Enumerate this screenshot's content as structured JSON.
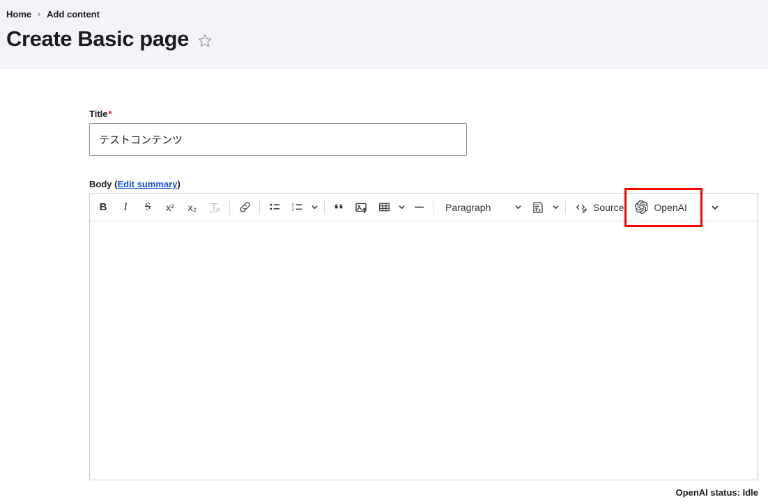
{
  "header": {
    "breadcrumb": [
      {
        "label": "Home",
        "icon": ""
      },
      {
        "label": "Add content",
        "icon": ""
      }
    ],
    "separator": "›",
    "title": "Create Basic page",
    "star_icon": "star-outline-icon",
    "bg_color": "#f3f4f9"
  },
  "form": {
    "title_field": {
      "label": "Title",
      "required_mark": "*",
      "value": "テストコンテンツ",
      "placeholder": ""
    },
    "body_field": {
      "label_prefix": "Body (",
      "edit_summary_link": "Edit summary",
      "label_suffix": ")",
      "content": "",
      "placeholder": ""
    }
  },
  "editor": {
    "toolbar": [
      {
        "id": "bold",
        "name": "bold-button",
        "label": "B",
        "kind": "text-icon"
      },
      {
        "id": "italic",
        "name": "italic-button",
        "label": "I",
        "kind": "text-icon"
      },
      {
        "id": "strikethrough",
        "name": "strikethrough-button",
        "label": "S",
        "kind": "text-icon"
      },
      {
        "id": "superscript",
        "name": "superscript-button",
        "label": "x²",
        "kind": "text-icon"
      },
      {
        "id": "subscript",
        "name": "subscript-button",
        "label": "x₂",
        "kind": "text-icon"
      },
      {
        "id": "remove-format",
        "name": "remove-format-button",
        "label": "Tx",
        "kind": "text-icon",
        "disabled": true
      },
      {
        "id": "link",
        "name": "link-icon",
        "label": "Link",
        "kind": "svg"
      },
      {
        "id": "bulleted-list",
        "name": "bulleted-list-icon",
        "label": "Bulleted List",
        "kind": "svg"
      },
      {
        "id": "numbered-list",
        "name": "numbered-list-icon",
        "label": "Numbered List",
        "kind": "svg"
      },
      {
        "id": "list-dropdown",
        "name": "list-dropdown-chevron-icon",
        "label": "List options",
        "kind": "chevron"
      },
      {
        "id": "blockquote",
        "name": "blockquote-icon",
        "label": "Block quote",
        "kind": "svg"
      },
      {
        "id": "image",
        "name": "image-upload-icon",
        "label": "Insert image",
        "kind": "svg"
      },
      {
        "id": "table",
        "name": "table-icon",
        "label": "Insert table",
        "kind": "svg"
      },
      {
        "id": "table-dropdown",
        "name": "table-dropdown-chevron-icon",
        "label": "Table options",
        "kind": "chevron"
      },
      {
        "id": "horizontal-rule",
        "name": "horizontal-rule-icon",
        "label": "Horizontal line",
        "kind": "svg"
      },
      {
        "id": "paragraph-style",
        "name": "paragraph-style-dropdown",
        "label": "Paragraph",
        "kind": "dropdown"
      },
      {
        "id": "template",
        "name": "template-icon",
        "label": "Templates",
        "kind": "svg"
      },
      {
        "id": "template-dropdown",
        "name": "template-dropdown-chevron-icon",
        "label": "Template options",
        "kind": "chevron"
      },
      {
        "id": "source",
        "name": "source-editing-button",
        "label": "Source",
        "kind": "labelled"
      },
      {
        "id": "openai",
        "name": "openai-button",
        "label": "OpenAI",
        "kind": "labelled"
      },
      {
        "id": "show-more",
        "name": "show-more-items-chevron-icon",
        "label": "Show more items",
        "kind": "chevron"
      }
    ],
    "highlight": {
      "target": "openai-button",
      "color": "#ff0000"
    }
  },
  "status": {
    "text": "OpenAI status: Idle"
  }
}
